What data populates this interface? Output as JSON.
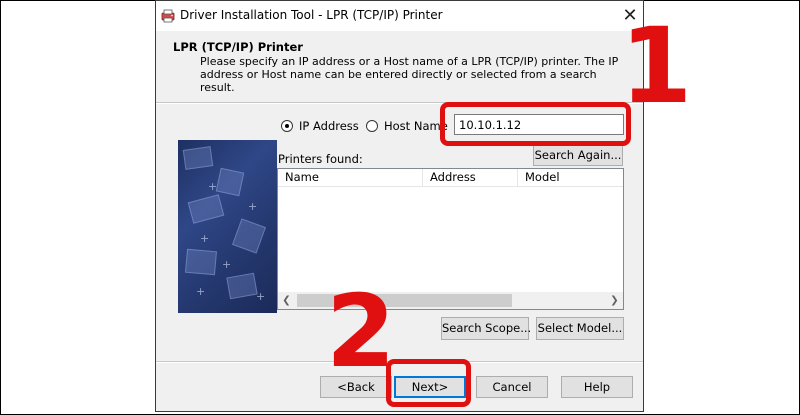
{
  "window": {
    "title": "Driver Installation Tool - LPR (TCP/IP) Printer",
    "app_icon": "printer-app-icon",
    "close_glyph": "✕"
  },
  "header": {
    "title": "LPR (TCP/IP) Printer",
    "description": "Please specify an IP address or a Host name of a LPR (TCP/IP) printer. The IP address or Host name can be entered directly or selected from a search result."
  },
  "form": {
    "radio_ip_label": "IP Address",
    "radio_host_label": "Host Name",
    "selected_radio": "IP Address",
    "address_value": "10.10.1.12",
    "search_again_label": "Search Again...",
    "printers_found_label": "Printers found:",
    "columns": [
      "Name",
      "Address",
      "Model"
    ],
    "rows": [],
    "search_scope_label": "Search Scope...",
    "select_model_label": "Select Model..."
  },
  "footer": {
    "back_label": "<Back",
    "next_label": "Next>",
    "cancel_label": "Cancel",
    "help_label": "Help"
  },
  "annotations": {
    "step1": "1",
    "step2": "2",
    "highlight_color": "#e01010"
  }
}
